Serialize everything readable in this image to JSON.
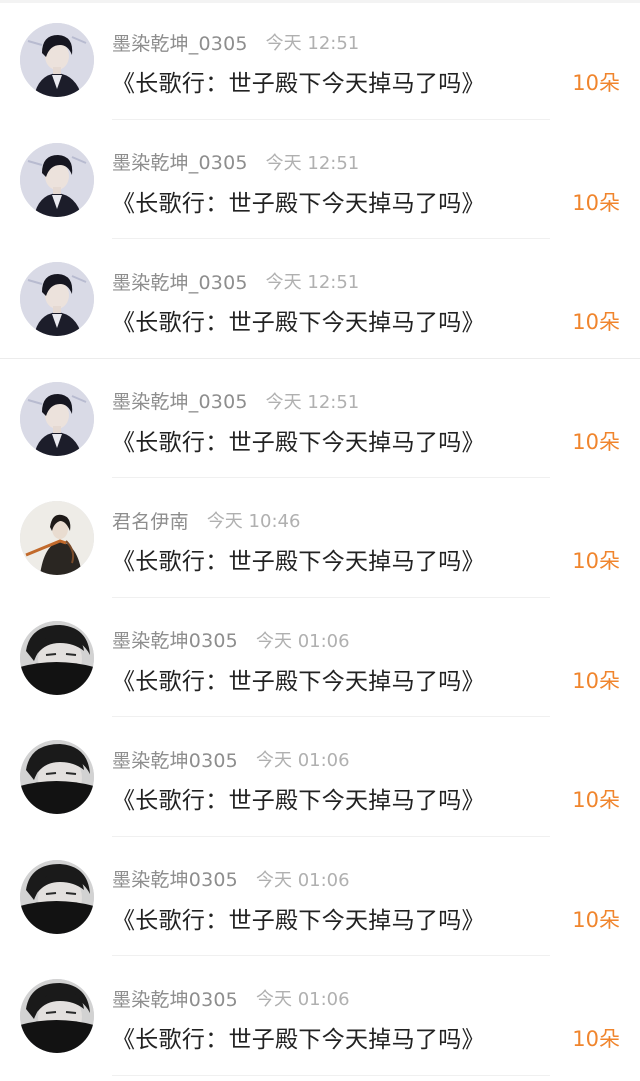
{
  "colors": {
    "gift_accent": "#f0852d",
    "username_gray": "#8e8e8e",
    "time_gray": "#b0b0b0",
    "message_text": "#222222"
  },
  "comments": [
    {
      "username": "墨染乾坤_0305",
      "time": "今天 12:51",
      "message": "《长歌行：世子殿下今天掉马了吗》",
      "gift": "10朵",
      "avatar": "avatar-young-man-dark-suit"
    },
    {
      "username": "墨染乾坤_0305",
      "time": "今天 12:51",
      "message": "《长歌行：世子殿下今天掉马了吗》",
      "gift": "10朵",
      "avatar": "avatar-young-man-dark-suit"
    },
    {
      "username": "墨染乾坤_0305",
      "time": "今天 12:51",
      "message": "《长歌行：世子殿下今天掉马了吗》",
      "gift": "10朵",
      "avatar": "avatar-young-man-dark-suit"
    },
    {
      "username": "墨染乾坤_0305",
      "time": "今天 12:51",
      "message": "《长歌行：世子殿下今天掉马了吗》",
      "gift": "10朵",
      "avatar": "avatar-young-man-dark-suit"
    },
    {
      "username": "君名伊南",
      "time": "今天 10:46",
      "message": "《长歌行：世子殿下今天掉马了吗》",
      "gift": "10朵",
      "avatar": "avatar-costume-figure"
    },
    {
      "username": "墨染乾坤0305",
      "time": "今天 01:06",
      "message": "《长歌行：世子殿下今天掉马了吗》",
      "gift": "10朵",
      "avatar": "avatar-masked-man"
    },
    {
      "username": "墨染乾坤0305",
      "time": "今天 01:06",
      "message": "《长歌行：世子殿下今天掉马了吗》",
      "gift": "10朵",
      "avatar": "avatar-masked-man"
    },
    {
      "username": "墨染乾坤0305",
      "time": "今天 01:06",
      "message": "《长歌行：世子殿下今天掉马了吗》",
      "gift": "10朵",
      "avatar": "avatar-masked-man"
    },
    {
      "username": "墨染乾坤0305",
      "time": "今天 01:06",
      "message": "《长歌行：世子殿下今天掉马了吗》",
      "gift": "10朵",
      "avatar": "avatar-masked-man"
    }
  ]
}
